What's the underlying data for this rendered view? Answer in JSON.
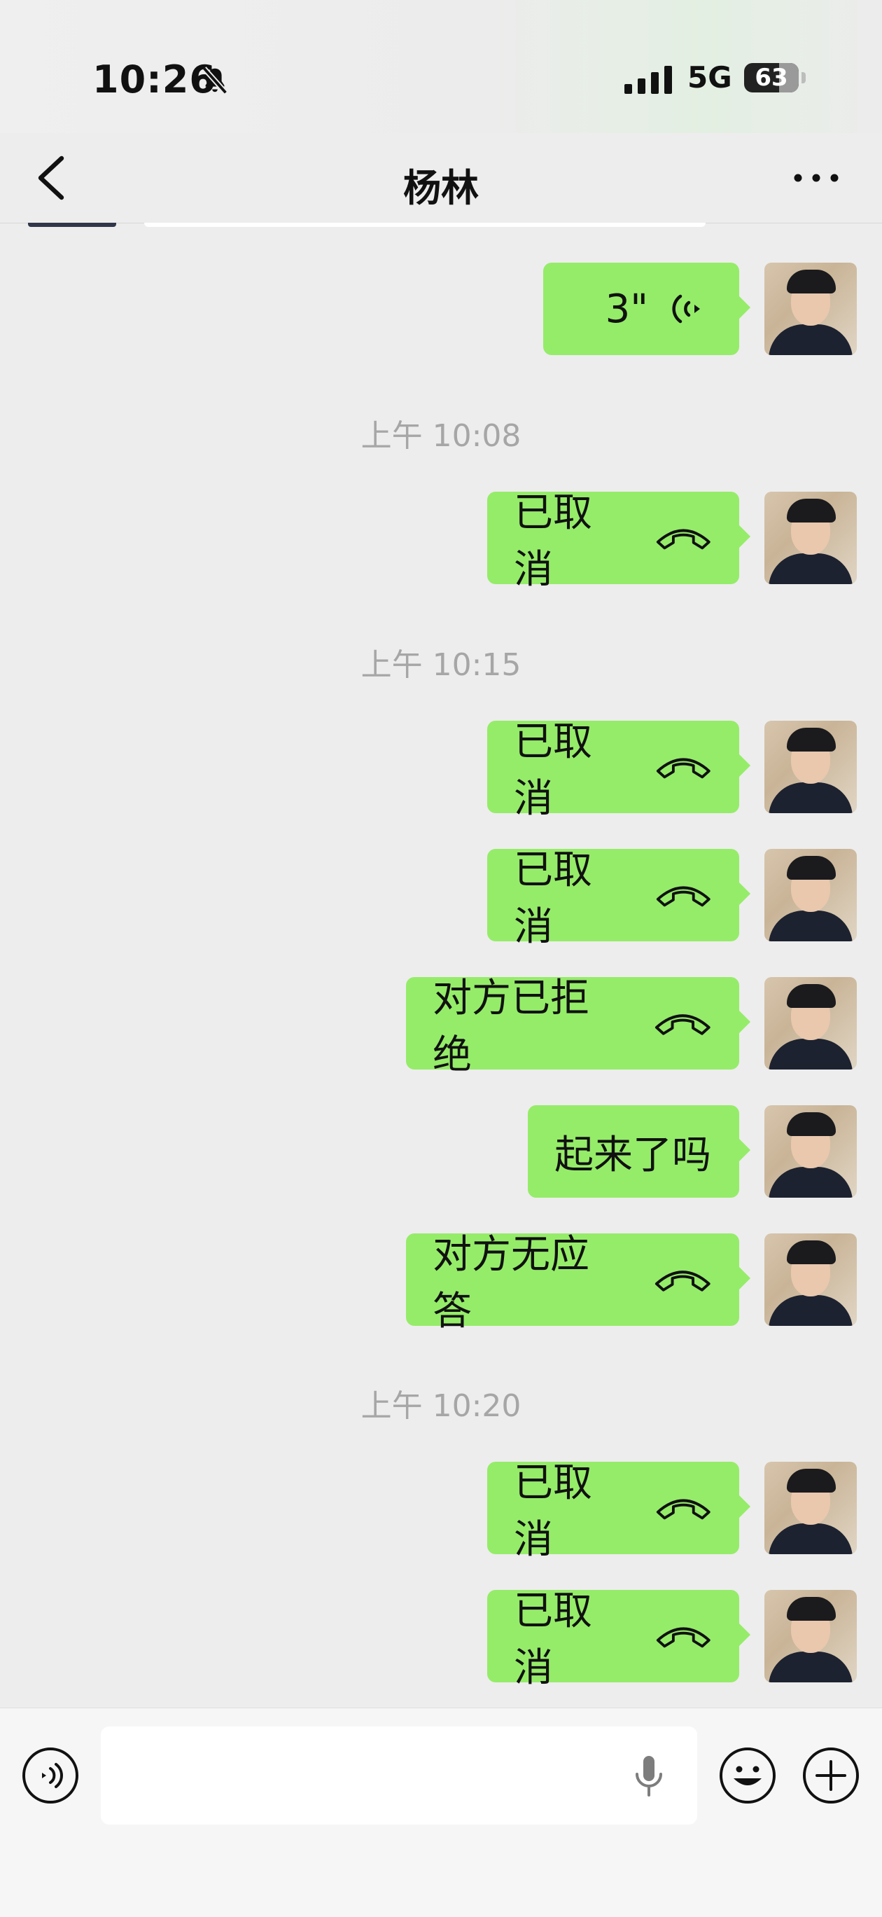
{
  "status_bar": {
    "time": "10:26",
    "network": "5G",
    "battery": "63"
  },
  "header": {
    "title": "杨林"
  },
  "messages": [
    {
      "type": "voice",
      "text": "3\""
    },
    {
      "type": "timestamp",
      "text": "上午 10:08"
    },
    {
      "type": "call",
      "text": "已取消"
    },
    {
      "type": "timestamp",
      "text": "上午 10:15"
    },
    {
      "type": "call",
      "text": "已取消"
    },
    {
      "type": "call",
      "text": "已取消"
    },
    {
      "type": "call",
      "text": "对方已拒绝"
    },
    {
      "type": "text",
      "text": "起来了吗"
    },
    {
      "type": "call",
      "text": "对方无应答"
    },
    {
      "type": "timestamp",
      "text": "上午 10:20"
    },
    {
      "type": "call",
      "text": "已取消"
    },
    {
      "type": "call",
      "text": "已取消"
    }
  ],
  "input_bar": {
    "value": "",
    "placeholder": ""
  },
  "icons": {
    "back": "chevron-left-icon",
    "more": "more-dots-icon",
    "voice": "voice-wave-icon",
    "call": "phone-hangup-icon",
    "voice_input": "voice-input-icon",
    "mic": "microphone-icon",
    "emoji": "emoji-icon",
    "add": "plus-icon",
    "bell": "bell-slash-icon"
  },
  "colors": {
    "bubble": "#95ec69",
    "background": "#ededed",
    "timestamp": "#a6a6a6"
  }
}
